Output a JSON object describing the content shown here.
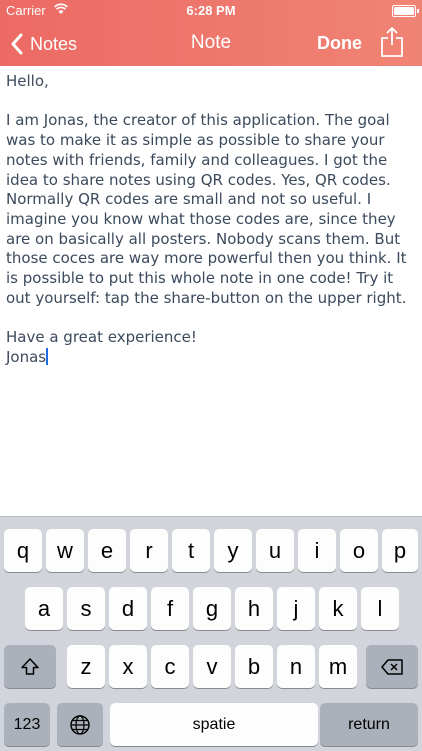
{
  "status_bar": {
    "carrier": "Carrier",
    "time": "6:28 PM"
  },
  "nav": {
    "back_label": "Notes",
    "title": "Note",
    "done_label": "Done"
  },
  "note": {
    "body": "Hello,\n\nI am Jonas, the creator of this application. The goal was to make it as simple as possible to share your notes with friends, family and colleagues. I got the idea to share notes using QR codes. Yes, QR codes. Normally QR codes are small and not so useful. I imagine you know what those codes are, since they are on basically all posters. Nobody scans them. But those coces are way more powerful then you think. It is possible to put this whole note in one code! Try it out yourself: tap the share-button on the upper right.\n\nHave a great experience!\nJonas"
  },
  "keyboard": {
    "row1": [
      "q",
      "w",
      "e",
      "r",
      "t",
      "y",
      "u",
      "i",
      "o",
      "p"
    ],
    "row2": [
      "a",
      "s",
      "d",
      "f",
      "g",
      "h",
      "j",
      "k",
      "l"
    ],
    "row3": [
      "z",
      "x",
      "c",
      "v",
      "b",
      "n",
      "m"
    ],
    "numbers_label": "123",
    "space_label": "spatie",
    "return_label": "return",
    "icons": {
      "shift": "shift-arrow-icon",
      "delete": "backspace-icon",
      "globe": "globe-icon"
    }
  },
  "colors": {
    "header_start": "#ec6a64",
    "header_end": "#f08474",
    "text": "#3b4a5c",
    "caret": "#1b6de0"
  }
}
